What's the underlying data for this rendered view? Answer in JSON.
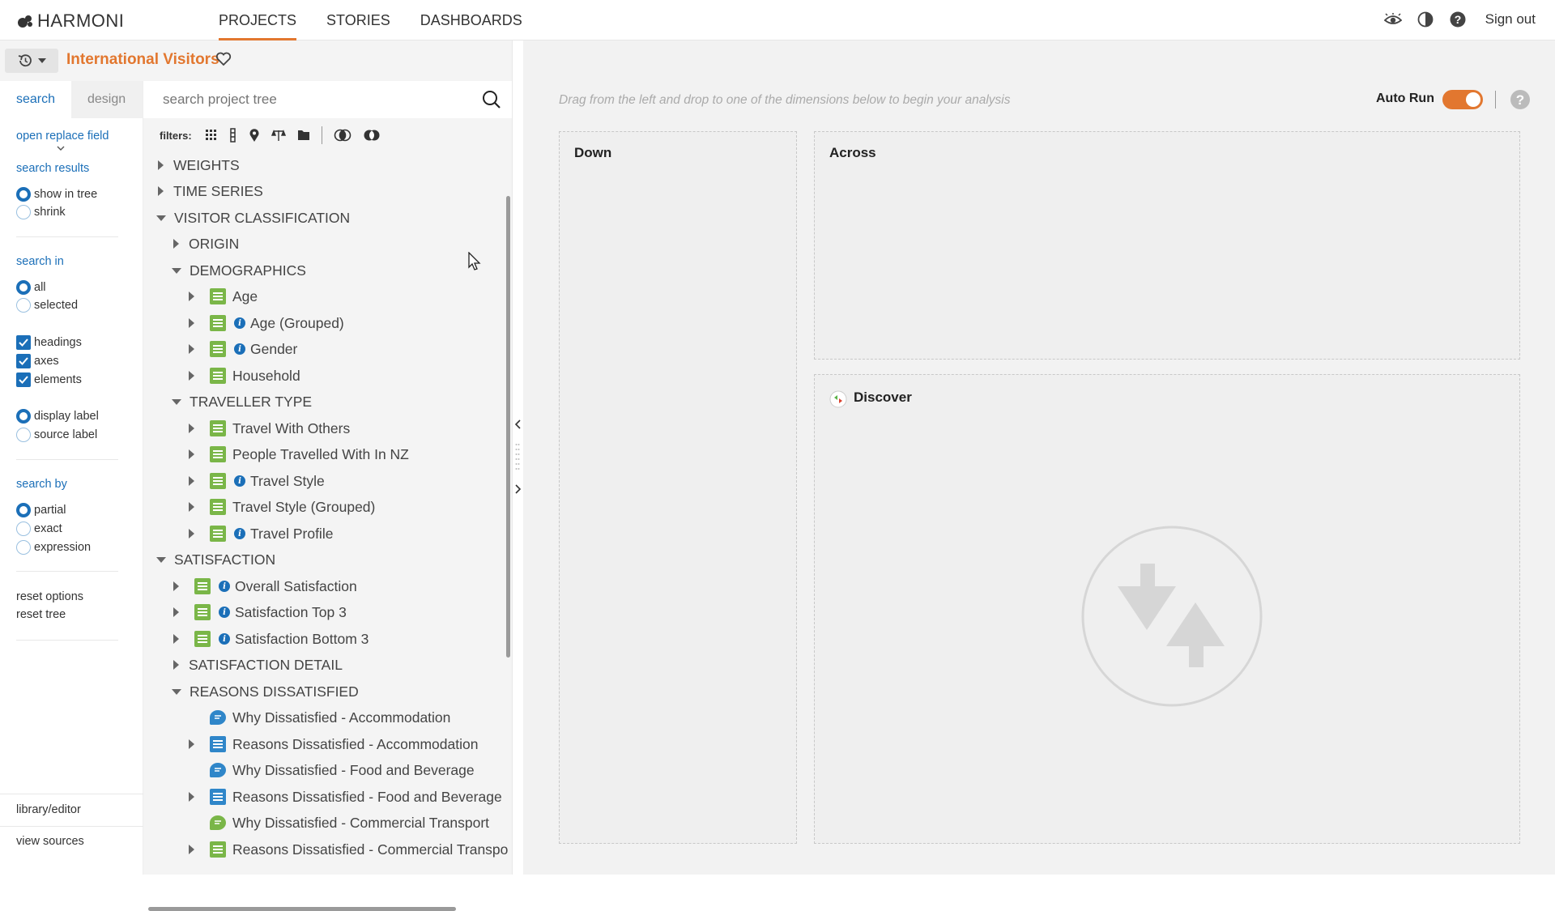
{
  "app": {
    "logo": "HARMONI",
    "nav": [
      "PROJECTS",
      "STORIES",
      "DASHBOARDS"
    ],
    "sign_out": "Sign out"
  },
  "project": {
    "title": "International Visitors"
  },
  "options": {
    "tabs": {
      "search": "search",
      "design": "design"
    },
    "open_replace": "open replace field",
    "search_results": "search results",
    "show_in_tree": "show in tree",
    "shrink": "shrink",
    "search_in": "search in",
    "all": "all",
    "selected": "selected",
    "headings": "headings",
    "axes": "axes",
    "elements": "elements",
    "display_label": "display label",
    "source_label": "source label",
    "search_by": "search by",
    "partial": "partial",
    "exact": "exact",
    "expression": "expression",
    "reset_options": "reset options",
    "reset_tree": "reset tree",
    "library_editor": "library/editor",
    "view_sources": "view sources"
  },
  "tree_search": {
    "placeholder": "search project tree",
    "filters_label": "filters:"
  },
  "tree": [
    {
      "label": "WEIGHTS"
    },
    {
      "label": "TIME SERIES"
    },
    {
      "label": "VISITOR CLASSIFICATION"
    },
    {
      "label": "ORIGIN"
    },
    {
      "label": "DEMOGRAPHICS"
    },
    {
      "label": "Age"
    },
    {
      "label": "Age (Grouped)"
    },
    {
      "label": "Gender"
    },
    {
      "label": "Household"
    },
    {
      "label": "TRAVELLER TYPE"
    },
    {
      "label": "Travel With Others"
    },
    {
      "label": "People Travelled With In NZ"
    },
    {
      "label": "Travel Style"
    },
    {
      "label": "Travel Style (Grouped)"
    },
    {
      "label": "Travel Profile"
    },
    {
      "label": "SATISFACTION"
    },
    {
      "label": "Overall Satisfaction"
    },
    {
      "label": "Satisfaction Top 3"
    },
    {
      "label": "Satisfaction Bottom 3"
    },
    {
      "label": "SATISFACTION DETAIL"
    },
    {
      "label": "REASONS DISSATISFIED"
    },
    {
      "label": "Why Dissatisfied - Accommodation"
    },
    {
      "label": "Reasons Dissatisfied - Accommodation"
    },
    {
      "label": "Why Dissatisfied - Food and Beverage"
    },
    {
      "label": "Reasons Dissatisfied - Food and Beverage"
    },
    {
      "label": "Why Dissatisfied - Commercial Transport"
    },
    {
      "label": "Reasons Dissatisfied - Commercial Transport"
    }
  ],
  "analysis": {
    "hint": "Drag from the left and drop to one of the dimensions below to begin your analysis",
    "auto_run": "Auto Run",
    "down": "Down",
    "across": "Across",
    "discover": "Discover"
  },
  "colors": {
    "accent": "#e2772f",
    "link": "#1b6fb8",
    "leaf_green": "#7ab648",
    "leaf_blue": "#2f86c9"
  }
}
